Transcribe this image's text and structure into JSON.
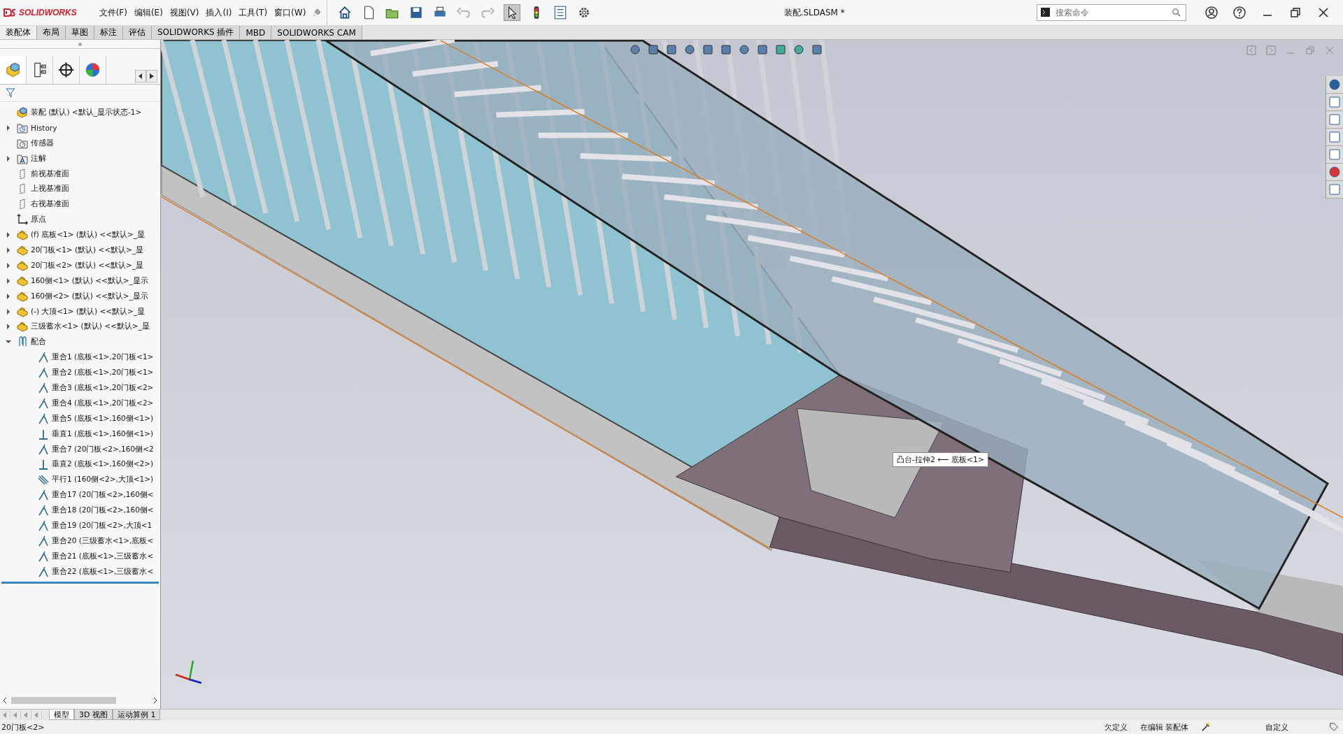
{
  "window": {
    "logo": "SOLIDWORKS",
    "title": "装配.SLDASM *"
  },
  "menu": [
    "文件(F)",
    "编辑(E)",
    "视图(V)",
    "插入(I)",
    "工具(T)",
    "窗口(W)"
  ],
  "search": {
    "placeholder": "搜索命令"
  },
  "command_tabs": [
    {
      "label": "装配体",
      "selected": true
    },
    {
      "label": "布局",
      "selected": false
    },
    {
      "label": "草图",
      "selected": false
    },
    {
      "label": "标注",
      "selected": false
    },
    {
      "label": "评估",
      "selected": false
    },
    {
      "label": "SOLIDWORKS 插件",
      "selected": false
    },
    {
      "label": "MBD",
      "selected": false
    },
    {
      "label": "SOLIDWORKS CAM",
      "selected": false
    }
  ],
  "feature_tree": {
    "root": "装配 (默认) <默认_显示状态-1>",
    "items": [
      {
        "label": "History",
        "kind": "history",
        "expanded": false
      },
      {
        "label": "传感器",
        "kind": "sensor"
      },
      {
        "label": "注解",
        "kind": "annotation",
        "expanded": false
      },
      {
        "label": "前视基准面",
        "kind": "plane"
      },
      {
        "label": "上视基准面",
        "kind": "plane"
      },
      {
        "label": "右视基准面",
        "kind": "plane"
      },
      {
        "label": "原点",
        "kind": "origin"
      },
      {
        "label": "(f) 底板<1> (默认) <<默认>_显",
        "kind": "part",
        "expanded": false
      },
      {
        "label": "20门板<1> (默认) <<默认>_显",
        "kind": "part",
        "expanded": false
      },
      {
        "label": "20门板<2> (默认) <<默认>_显",
        "kind": "part",
        "expanded": false
      },
      {
        "label": "160侧<1> (默认) <<默认>_显示",
        "kind": "part",
        "expanded": false
      },
      {
        "label": "160侧<2> (默认) <<默认>_显示",
        "kind": "part",
        "expanded": false
      },
      {
        "label": "(-) 大顶<1> (默认) <<默认>_显",
        "kind": "part",
        "expanded": false
      },
      {
        "label": "三级蓄水<1> (默认) <<默认>_显",
        "kind": "part",
        "expanded": false
      },
      {
        "label": "配合",
        "kind": "mates",
        "expanded": true,
        "children": [
          {
            "label": "重合1 (底板<1>,20门板<1>",
            "kind": "coincident"
          },
          {
            "label": "重合2 (底板<1>,20门板<1>",
            "kind": "coincident"
          },
          {
            "label": "重合3 (底板<1>,20门板<2>",
            "kind": "coincident"
          },
          {
            "label": "重合4 (底板<1>,20门板<2>",
            "kind": "coincident"
          },
          {
            "label": "重合5 (底板<1>,160侧<1>)",
            "kind": "coincident"
          },
          {
            "label": "垂直1 (底板<1>,160侧<1>)",
            "kind": "perpendicular"
          },
          {
            "label": "重合7 (20门板<2>,160侧<2",
            "kind": "coincident"
          },
          {
            "label": "垂直2 (底板<1>,160侧<2>)",
            "kind": "perpendicular"
          },
          {
            "label": "平行1 (160侧<2>,大顶<1>)",
            "kind": "parallel"
          },
          {
            "label": "重合17 (20门板<2>,160侧<",
            "kind": "coincident"
          },
          {
            "label": "重合18 (20门板<2>,160侧<",
            "kind": "coincident"
          },
          {
            "label": "重合19 (20门板<2>,大顶<1",
            "kind": "coincident"
          },
          {
            "label": "重合20 (三级蓄水<1>,底板<",
            "kind": "coincident"
          },
          {
            "label": "重合21 (底板<1>,三级蓄水<",
            "kind": "coincident"
          },
          {
            "label": "重合22 (底板<1>,三级蓄水<",
            "kind": "coincident"
          }
        ]
      }
    ]
  },
  "viewport": {
    "tooltip": "凸台-拉伸2 ⟵ 底板<1>"
  },
  "bottom_tabs": [
    {
      "label": "模型",
      "selected": true
    },
    {
      "label": "3D 视图",
      "selected": false
    },
    {
      "label": "运动算例 1",
      "selected": false
    }
  ],
  "status_bar": {
    "selection": "20门板<2>",
    "state": "欠定义",
    "mode": "在编辑 装配体",
    "units": "自定义"
  }
}
